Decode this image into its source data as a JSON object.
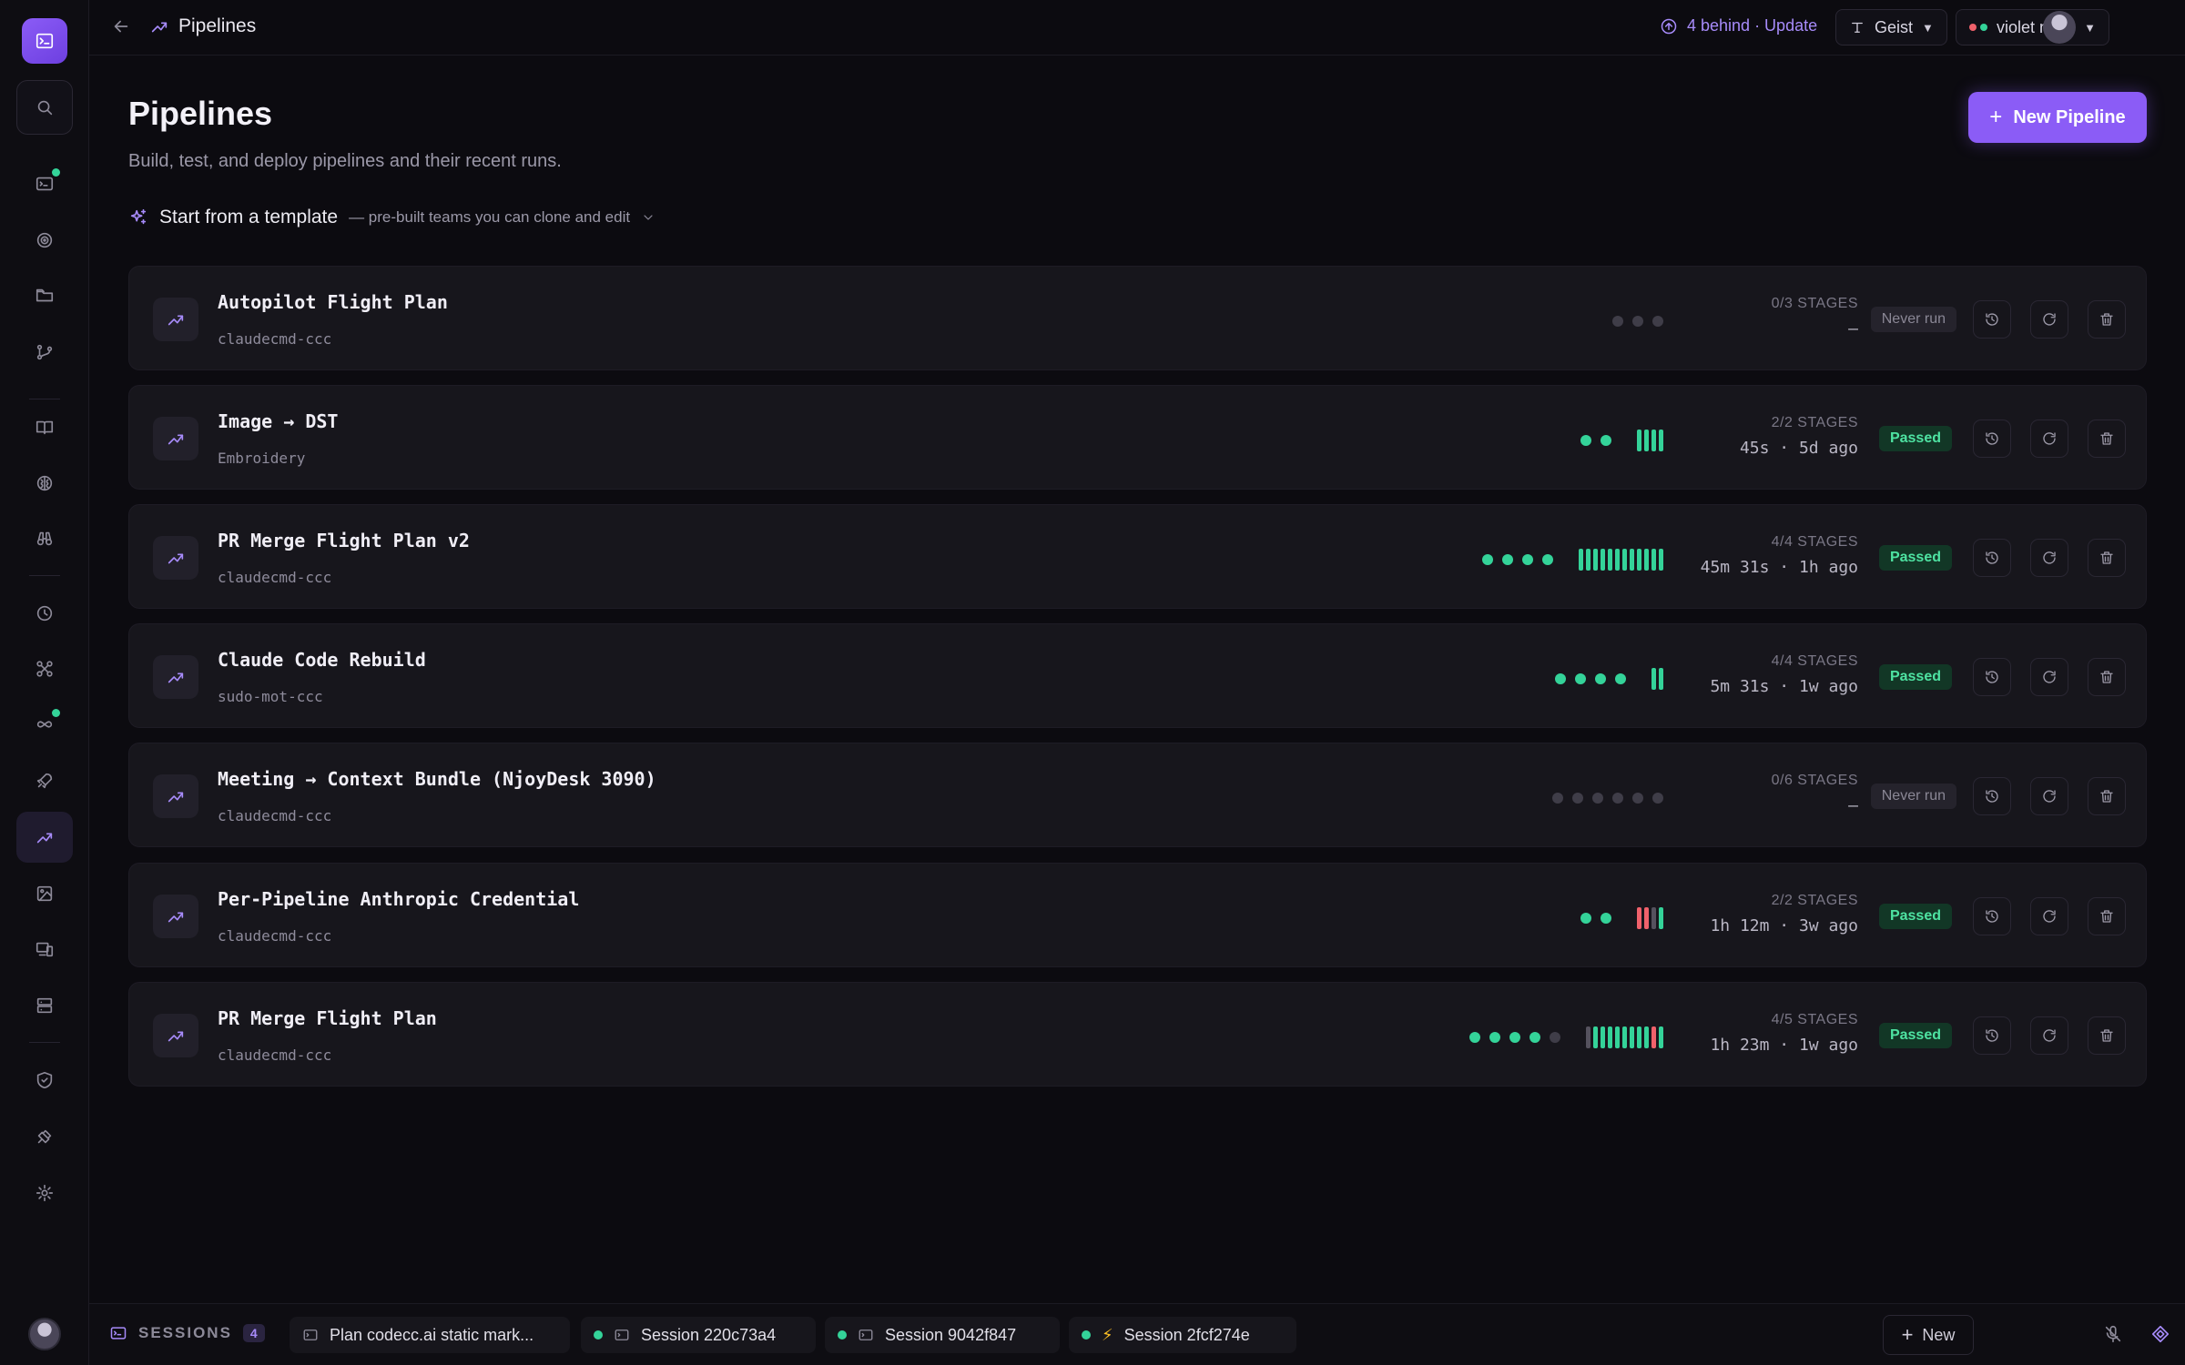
{
  "topbar": {
    "title": "Pipelines",
    "update_text": "4 behind · Update",
    "font_select": "Geist",
    "theme_select": "violet night"
  },
  "page": {
    "title": "Pipelines",
    "subtitle": "Build, test, and deploy pipelines and their recent runs.",
    "new_button": "New Pipeline",
    "template_title": "Start from a template",
    "template_sub": "— pre-built teams you can clone and edit"
  },
  "pipelines": [
    {
      "name": "Autopilot Flight Plan",
      "sub": "claudecmd-ccc",
      "stages": "0/3 STAGES",
      "time": "—",
      "status": "Never run",
      "dots": [
        "gray",
        "gray",
        "gray"
      ],
      "bars": []
    },
    {
      "name": "Image → DST",
      "sub": "Embroidery",
      "stages": "2/2 STAGES",
      "time": "45s · 5d ago",
      "status": "Passed",
      "dots": [
        "green",
        "green"
      ],
      "bars": [
        "green",
        "green",
        "green",
        "green"
      ]
    },
    {
      "name": "PR Merge Flight Plan v2",
      "sub": "claudecmd-ccc",
      "stages": "4/4 STAGES",
      "time": "45m 31s · 1h ago",
      "status": "Passed",
      "dots": [
        "green",
        "green",
        "green",
        "green"
      ],
      "bars": [
        "green",
        "green",
        "green",
        "green",
        "green",
        "green",
        "green",
        "green",
        "green",
        "green",
        "green",
        "green"
      ]
    },
    {
      "name": "Claude Code Rebuild",
      "sub": "sudo-mot-ccc",
      "stages": "4/4 STAGES",
      "time": "5m 31s · 1w ago",
      "status": "Passed",
      "dots": [
        "green",
        "green",
        "green",
        "green"
      ],
      "bars": [
        "green",
        "green"
      ]
    },
    {
      "name": "Meeting → Context Bundle (NjoyDesk 3090)",
      "sub": "claudecmd-ccc",
      "stages": "0/6 STAGES",
      "time": "—",
      "status": "Never run",
      "dots": [
        "gray",
        "gray",
        "gray",
        "gray",
        "gray",
        "gray"
      ],
      "bars": []
    },
    {
      "name": "Per-Pipeline Anthropic Credential",
      "sub": "claudecmd-ccc",
      "stages": "2/2 STAGES",
      "time": "1h 12m · 3w ago",
      "status": "Passed",
      "dots": [
        "green",
        "green"
      ],
      "bars": [
        "red",
        "red",
        "gray",
        "green"
      ]
    },
    {
      "name": "PR Merge Flight Plan",
      "sub": "claudecmd-ccc",
      "stages": "4/5 STAGES",
      "time": "1h 23m · 1w ago",
      "status": "Passed",
      "dots": [
        "green",
        "green",
        "green",
        "green",
        "gray"
      ],
      "bars": [
        "gray",
        "green",
        "green",
        "green",
        "green",
        "green",
        "green",
        "green",
        "green",
        "red",
        "green"
      ]
    }
  ],
  "bottombar": {
    "sessions_label": "SESSIONS",
    "sessions_count": "4",
    "tabs": [
      {
        "label": "Plan codecc.ai static mark...",
        "status": "none",
        "icon": "terminal-icon"
      },
      {
        "label": "Session 220c73a4",
        "status": "green",
        "icon": "terminal-icon"
      },
      {
        "label": "Session 9042f847",
        "status": "green",
        "icon": "terminal-icon"
      },
      {
        "label": "Session 2fcf274e",
        "status": "green",
        "icon": "bolt-icon"
      }
    ],
    "new_label": "New"
  },
  "colors": {
    "accent": "#8b5cf6",
    "success": "#34d399",
    "error": "#f0616b",
    "background": "#0c0b10",
    "card": "#17161c"
  }
}
